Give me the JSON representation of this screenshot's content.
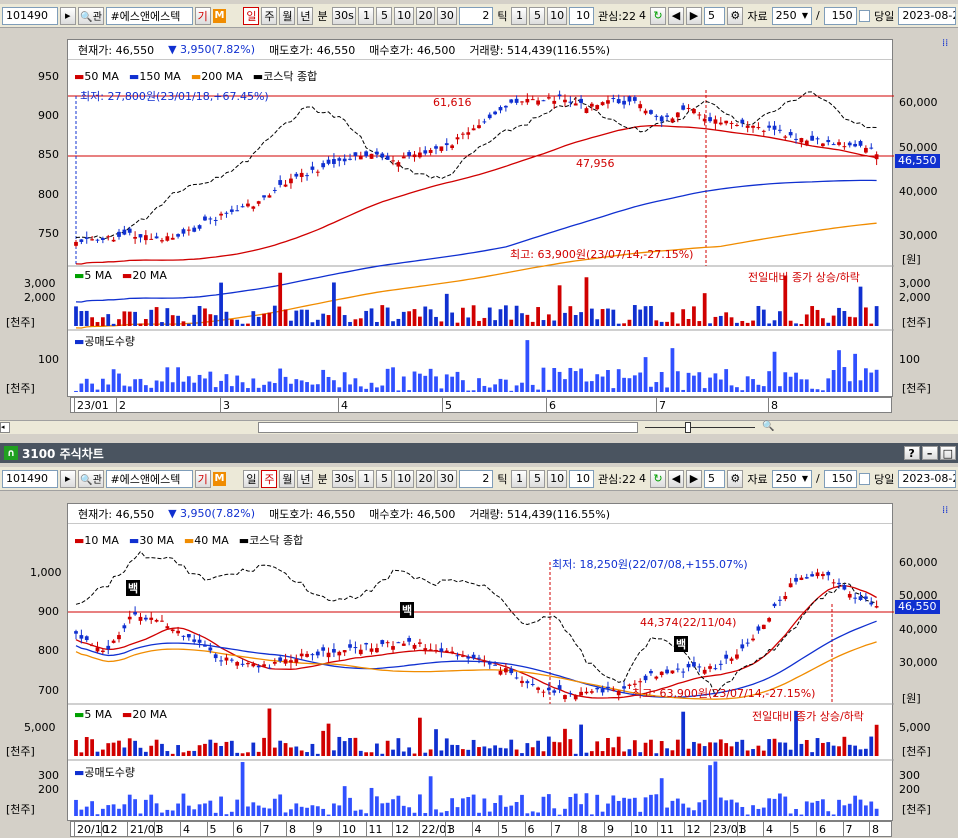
{
  "toolbar": {
    "code": "101490",
    "stock_name": "#에스앤에스텍",
    "gi": "기",
    "m": "M",
    "periods": [
      "일",
      "주",
      "월",
      "년"
    ],
    "bun": "분",
    "n30s": "30s",
    "nums": [
      "1",
      "5",
      "10",
      "20",
      "30"
    ],
    "tick_val": "2",
    "tick": "틱",
    "tnums": [
      "1",
      "5",
      "10"
    ],
    "ten": "10",
    "gwansim": "관심:22",
    "gwansim_n": "4",
    "step": "5",
    "jaryo": "자료",
    "jaryo_val": "250",
    "slash": "/",
    "total": "150",
    "dangil": "당일",
    "date": "2023-08-2"
  },
  "top": {
    "info": {
      "cur_label": "현재가:",
      "cur": "46,550",
      "chg": "▼ 3,950(7.82%)",
      "ask_label": "매도호가:",
      "ask": "46,550",
      "bid_label": "매수호가:",
      "bid": "46,500",
      "vol_label": "거래량:",
      "vol": "514,439(116.55%)"
    },
    "legend": [
      {
        "t": "50 MA",
        "c": "#d00000"
      },
      {
        "t": "150 MA",
        "c": "#1030d0"
      },
      {
        "t": "200 MA",
        "c": "#f08c00"
      },
      {
        "t": "코스닥 종합",
        "c": "#000000"
      }
    ],
    "left_axis": [
      "950",
      "900",
      "850",
      "800",
      "750"
    ],
    "right_axis": [
      "60,000",
      "50,000",
      "40,000",
      "30,000"
    ],
    "won": "[원]",
    "price_badge": "46,550",
    "ann_low": "최저: 27,800원(23/01/18,+67.45%)",
    "ann_high": "최고: 63,900원(23/07/14,-27.15%)",
    "ann_61616": "61,616",
    "ann_47956": "47,956",
    "vol_legend": [
      {
        "t": "5 MA",
        "c": "#00a000"
      },
      {
        "t": "20 MA",
        "c": "#d00000"
      }
    ],
    "vol_note": "전일대비 종가 상승/하락",
    "vol_left": [
      "3,000",
      "2,000",
      "[천주]"
    ],
    "vol_right": [
      "3,000",
      "2,000",
      "[천주]"
    ],
    "short_legend": "공매도수량",
    "short_left": [
      "100",
      "[천주]"
    ],
    "short_right": [
      "100",
      "[천주]"
    ],
    "xaxis": [
      "23/01",
      "2",
      "3",
      "4",
      "5",
      "6",
      "7",
      "8"
    ]
  },
  "window_title": "3100 주식차트",
  "bottom": {
    "info": {
      "cur_label": "현재가:",
      "cur": "46,550",
      "chg": "▼ 3,950(7.82%)",
      "ask_label": "매도호가:",
      "ask": "46,550",
      "bid_label": "매수호가:",
      "bid": "46,500",
      "vol_label": "거래량:",
      "vol": "514,439(116.55%)"
    },
    "legend": [
      {
        "t": "10 MA",
        "c": "#d00000"
      },
      {
        "t": "30 MA",
        "c": "#1030d0"
      },
      {
        "t": "40 MA",
        "c": "#f08c00"
      },
      {
        "t": "코스닥 종합",
        "c": "#000000"
      }
    ],
    "left_axis": [
      "1,000",
      "900",
      "800",
      "700"
    ],
    "right_axis": [
      "60,000",
      "50,000",
      "40,000",
      "30,000"
    ],
    "won": "[원]",
    "price_badge": "46,550",
    "ann_low": "최저: 18,250원(22/07/08,+155.07%)",
    "ann_high": "최고: 63,900원(23/07/14,-27.15%)",
    "ann_44374": "44,374(22/11/04)",
    "baek": "백",
    "vol_legend": [
      {
        "t": "5 MA",
        "c": "#00a000"
      },
      {
        "t": "20 MA",
        "c": "#d00000"
      }
    ],
    "vol_note": "전일대비 종가 상승/하락",
    "vol_left": [
      "5,000",
      "[천주]"
    ],
    "vol_right": [
      "5,000",
      "[천주]"
    ],
    "short_legend": "공매도수량",
    "short_left": [
      "300",
      "200",
      "[천주]"
    ],
    "short_right": [
      "300",
      "200",
      "[천주]"
    ],
    "xaxis": [
      "20/10",
      "12",
      "21/01",
      "3",
      "4",
      "5",
      "6",
      "7",
      "8",
      "9",
      "10",
      "11",
      "12",
      "22/01",
      "3",
      "4",
      "5",
      "6",
      "7",
      "8",
      "9",
      "10",
      "11",
      "12",
      "23/01",
      "3",
      "4",
      "5",
      "6",
      "7",
      "8"
    ]
  }
}
